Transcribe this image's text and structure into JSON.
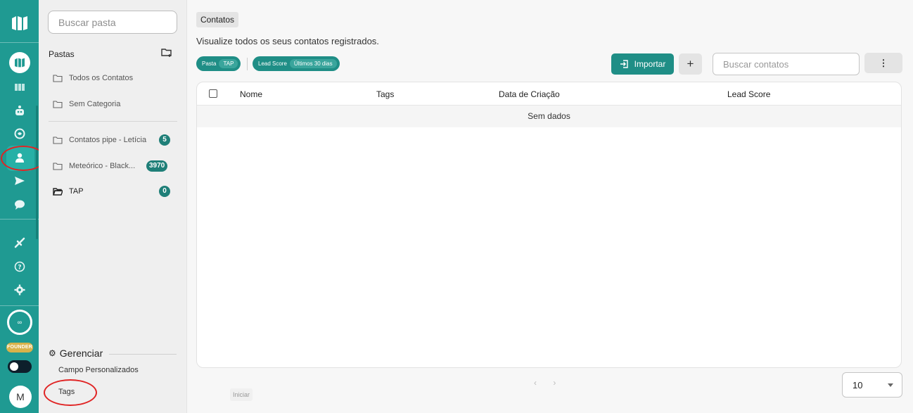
{
  "folder_panel": {
    "search_placeholder": "Buscar pasta",
    "pastas_label": "Pastas",
    "items": [
      {
        "label": "Todos os Contatos"
      },
      {
        "label": "Sem Categoria"
      },
      {
        "label": "Contatos pipe - Letícia",
        "count": "5"
      },
      {
        "label": "Meteórico - Black...",
        "count": "3970"
      },
      {
        "label": "TAP",
        "count": "0"
      }
    ],
    "manage": {
      "title": "Gerenciar",
      "items": [
        "Campo Personalizados",
        "Tags"
      ]
    }
  },
  "rail": {
    "founder_label": "FOUNDER",
    "infinity_label": "∞",
    "avatar_initial": "M",
    "icons": [
      "logo-icon",
      "app-logo-icon",
      "columns-icon",
      "robot-icon",
      "brain-icon",
      "contacts-icon",
      "send-icon",
      "chat-icon",
      "integrations-icon",
      "help-icon",
      "settings-icon"
    ]
  },
  "main": {
    "breadcrumb": "Contatos",
    "subtitle": "Visualize todos os seus contatos registrados.",
    "filters": [
      {
        "key": "Pasta",
        "value": "TAP"
      },
      {
        "key": "Lead Score",
        "value": "Últimos 30 dias"
      }
    ],
    "import_label": "Importar",
    "plus_label": "+",
    "search_placeholder": "Buscar contatos",
    "more_label": "⋮",
    "table": {
      "columns": [
        "Nome",
        "Tags",
        "Data de Criação",
        "Lead Score"
      ],
      "empty_text": "Sem dados"
    },
    "pager": {
      "prev": "‹",
      "next": "›"
    },
    "iniciar_label": "Iniciar",
    "page_size": "10"
  },
  "colors": {
    "brand": "#1f9a92",
    "brand_dark": "#1f8e86",
    "annotation_ring": "#e02424"
  }
}
